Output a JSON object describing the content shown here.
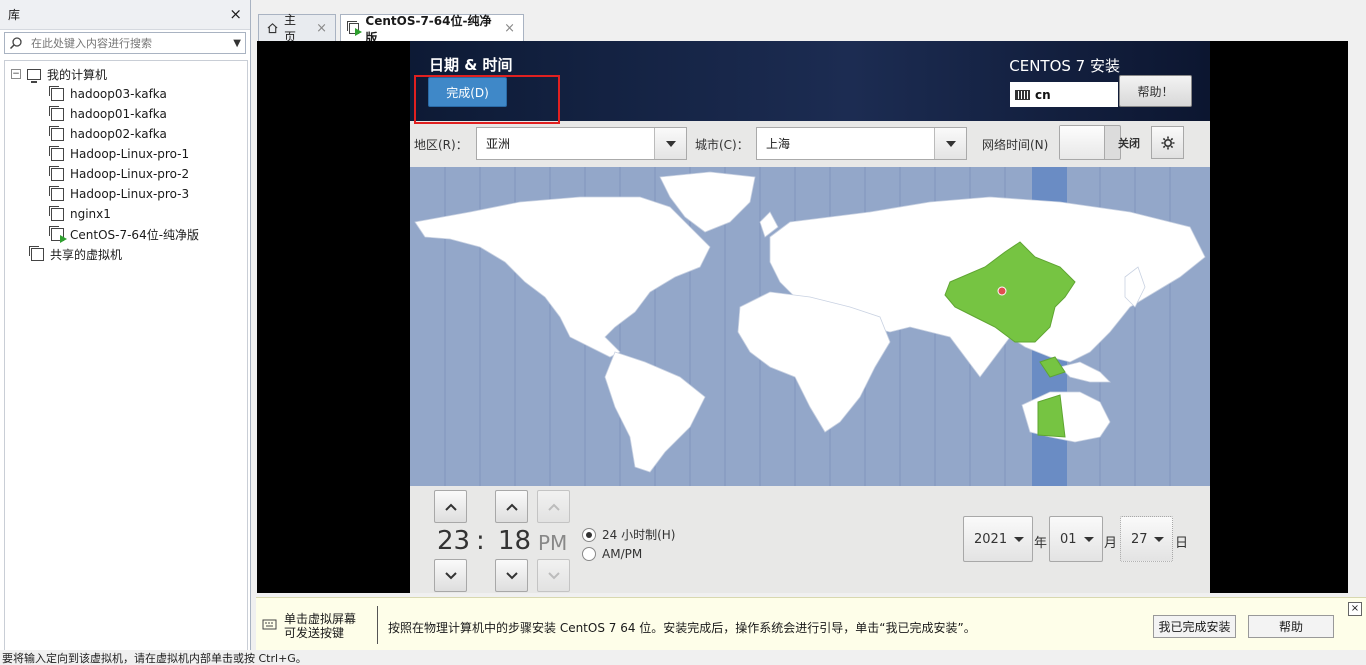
{
  "library": {
    "title": "库",
    "close": "×",
    "search_placeholder": "在此处键入内容进行搜索",
    "root": {
      "expander": "⊟",
      "label": "我的计算机"
    },
    "vms": [
      "hadoop03-kafka",
      "hadoop01-kafka",
      "hadoop02-kafka",
      "Hadoop-Linux-pro-1",
      "Hadoop-Linux-pro-2",
      "Hadoop-Linux-pro-3",
      "nginx1",
      "CentOS-7-64位-纯净版"
    ],
    "shared": "共享的虚拟机"
  },
  "tabs": {
    "home": "主页",
    "vm": "CentOS-7-64位-纯净版",
    "close": "×"
  },
  "installer": {
    "title": "日期 & 时间",
    "done": "完成(D)",
    "product": "CENTOS 7 安装",
    "keyboard": "cn",
    "help": "帮助！",
    "region_label": "地区(R)：",
    "region_value": "亚洲",
    "city_label": "城市(C)：",
    "city_value": "上海",
    "ntp_label": "网络时间(N)",
    "ntp_state": "关闭",
    "hour": "23",
    "colon": ":",
    "minute": "18",
    "ampm": "PM",
    "format_24": "24 小时制(H)",
    "format_ampm": "AM/PM",
    "year": "2021",
    "year_label": "年",
    "month": "01",
    "month_label": "月",
    "day": "27",
    "day_label": "日"
  },
  "hint": {
    "left_line1": "单击虚拟屏幕",
    "left_line2": "可发送按键",
    "text": "按照在物理计算机中的步骤安装 CentOS 7 64 位。安装完成后，操作系统会进行引导，单击“我已完成安装”。",
    "done_button": "我已完成安装",
    "help_button": "帮助",
    "close": "×"
  },
  "status": "要将输入定向到该虚拟机，请在虚拟机内部单击或按 Ctrl+G。",
  "colors": {
    "accent": "#3f88c8",
    "map_ocean": "#93a7c9",
    "land": "#ffffff",
    "selected_region": "#76c442",
    "timezone_highlight": "#6a8cc4",
    "highlight_box": "#e02020"
  }
}
